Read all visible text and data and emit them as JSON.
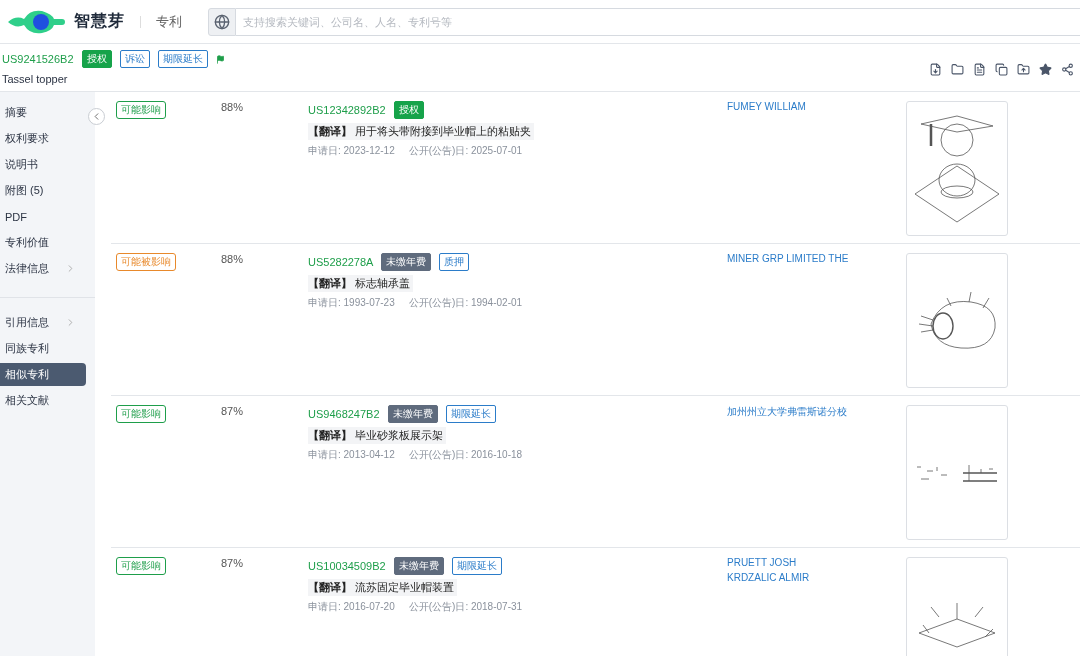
{
  "header": {
    "brand": "智慧芽",
    "section": "专利",
    "search": {
      "placeholder": "支持搜索关键词、公司名、人名、专利号等"
    }
  },
  "patent": {
    "number": "US9241526B2",
    "tags": [
      {
        "label": "授权",
        "kind": "solid-green"
      },
      {
        "label": "诉讼",
        "kind": "outline-blue"
      },
      {
        "label": "期限延长",
        "kind": "outline-blue"
      }
    ],
    "title": "Tassel topper"
  },
  "sidebar": {
    "groups": [
      {
        "items": [
          {
            "label": "摘要",
            "selected": false,
            "has_submenu": false
          },
          {
            "label": "权利要求",
            "selected": false,
            "has_submenu": false
          },
          {
            "label": "说明书",
            "selected": false,
            "has_submenu": false
          },
          {
            "label": "附图 (5)",
            "selected": false,
            "has_submenu": false
          },
          {
            "label": "PDF",
            "selected": false,
            "has_submenu": false
          },
          {
            "label": "专利价值",
            "selected": false,
            "has_submenu": false
          },
          {
            "label": "法律信息",
            "selected": false,
            "has_submenu": true
          }
        ]
      },
      {
        "items": [
          {
            "label": "引用信息",
            "selected": false,
            "has_submenu": true
          },
          {
            "label": "同族专利",
            "selected": false,
            "has_submenu": false
          },
          {
            "label": "相似专利",
            "selected": true,
            "has_submenu": false
          },
          {
            "label": "相关文献",
            "selected": false,
            "has_submenu": false
          }
        ]
      }
    ]
  },
  "results": [
    {
      "impact": {
        "label": "可能影响",
        "kind": "affects"
      },
      "similarity": "88%",
      "number": "US12342892B2",
      "tags": [
        {
          "label": "授权",
          "kind": "solid-green"
        }
      ],
      "title": "**【翻译】** 用于将头带附接到毕业帽上的粘贴夹",
      "application_date": "申请日: 2023-12-12",
      "publication_date": "公开(公告)日: 2025-07-01",
      "assignees": [
        "FUMEY WILLIAM"
      ]
    },
    {
      "impact": {
        "label": "可能被影响",
        "kind": "affected"
      },
      "similarity": "88%",
      "number": "US5282278A",
      "tags": [
        {
          "label": "未缴年费",
          "kind": "solid-gray"
        },
        {
          "label": "质押",
          "kind": "outline-blue"
        }
      ],
      "title": "**【翻译】** 标志轴承盖",
      "application_date": "申请日: 1993-07-23",
      "publication_date": "公开(公告)日: 1994-02-01",
      "assignees": [
        "MINER GRP LIMITED THE"
      ]
    },
    {
      "impact": {
        "label": "可能影响",
        "kind": "affects"
      },
      "similarity": "87%",
      "number": "US9468247B2",
      "tags": [
        {
          "label": "未缴年费",
          "kind": "solid-gray"
        },
        {
          "label": "期限延长",
          "kind": "outline-blue"
        }
      ],
      "title": "**【翻译】** 毕业砂浆板展示架",
      "application_date": "申请日: 2013-04-12",
      "publication_date": "公开(公告)日: 2016-10-18",
      "assignees": [
        "加州州立大学弗雷斯诺分校"
      ]
    },
    {
      "impact": {
        "label": "可能影响",
        "kind": "affects"
      },
      "similarity": "87%",
      "number": "US10034509B2",
      "tags": [
        {
          "label": "未缴年费",
          "kind": "solid-gray"
        },
        {
          "label": "期限延长",
          "kind": "outline-blue"
        }
      ],
      "title": "**【翻译】** 流苏固定毕业帽装置",
      "application_date": "申请日: 2016-07-20",
      "publication_date": "公开(公告)日: 2018-07-31",
      "assignees": [
        "PRUETT JOSH",
        "KRDZALIC ALMIR"
      ]
    }
  ]
}
